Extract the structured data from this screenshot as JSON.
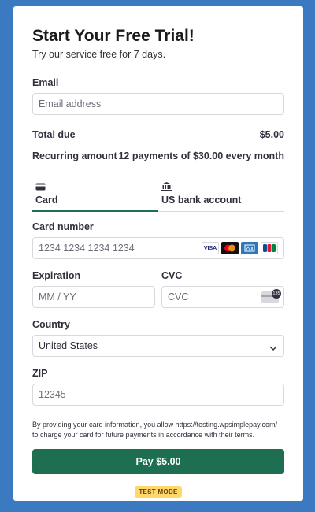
{
  "form": {
    "title": "Start Your Free Trial!",
    "subtitle": "Try our service free for 7 days.",
    "email_label": "Email",
    "email_placeholder": "Email address",
    "total_label": "Total due",
    "total_value": "$5.00",
    "recurring_label": "Recurring amount",
    "recurring_value": "12 payments of $30.00 every month"
  },
  "tabs": [
    {
      "label": "Card",
      "icon": "credit-card-icon",
      "active": true
    },
    {
      "label": "US bank account",
      "icon": "bank-icon",
      "active": false
    }
  ],
  "card": {
    "number_label": "Card number",
    "number_placeholder": "1234 1234 1234 1234",
    "brands": [
      "VISA",
      "Mastercard",
      "Amex",
      "JCB"
    ],
    "expiration_label": "Expiration",
    "expiration_placeholder": "MM / YY",
    "cvc_label": "CVC",
    "cvc_placeholder": "CVC",
    "cvc_icon_text": "135",
    "country_label": "Country",
    "country_value": "United States",
    "zip_label": "ZIP",
    "zip_placeholder": "12345"
  },
  "legal_text": "By providing your card information, you allow https://testing.wpsimplepay.com/ to charge your card for future payments in accordance with their terms.",
  "pay_button": "Pay $5.00",
  "test_mode_badge": "TEST MODE",
  "colors": {
    "accent": "#1e6e52",
    "background": "#3b79c1",
    "badge": "#ffd86b"
  }
}
